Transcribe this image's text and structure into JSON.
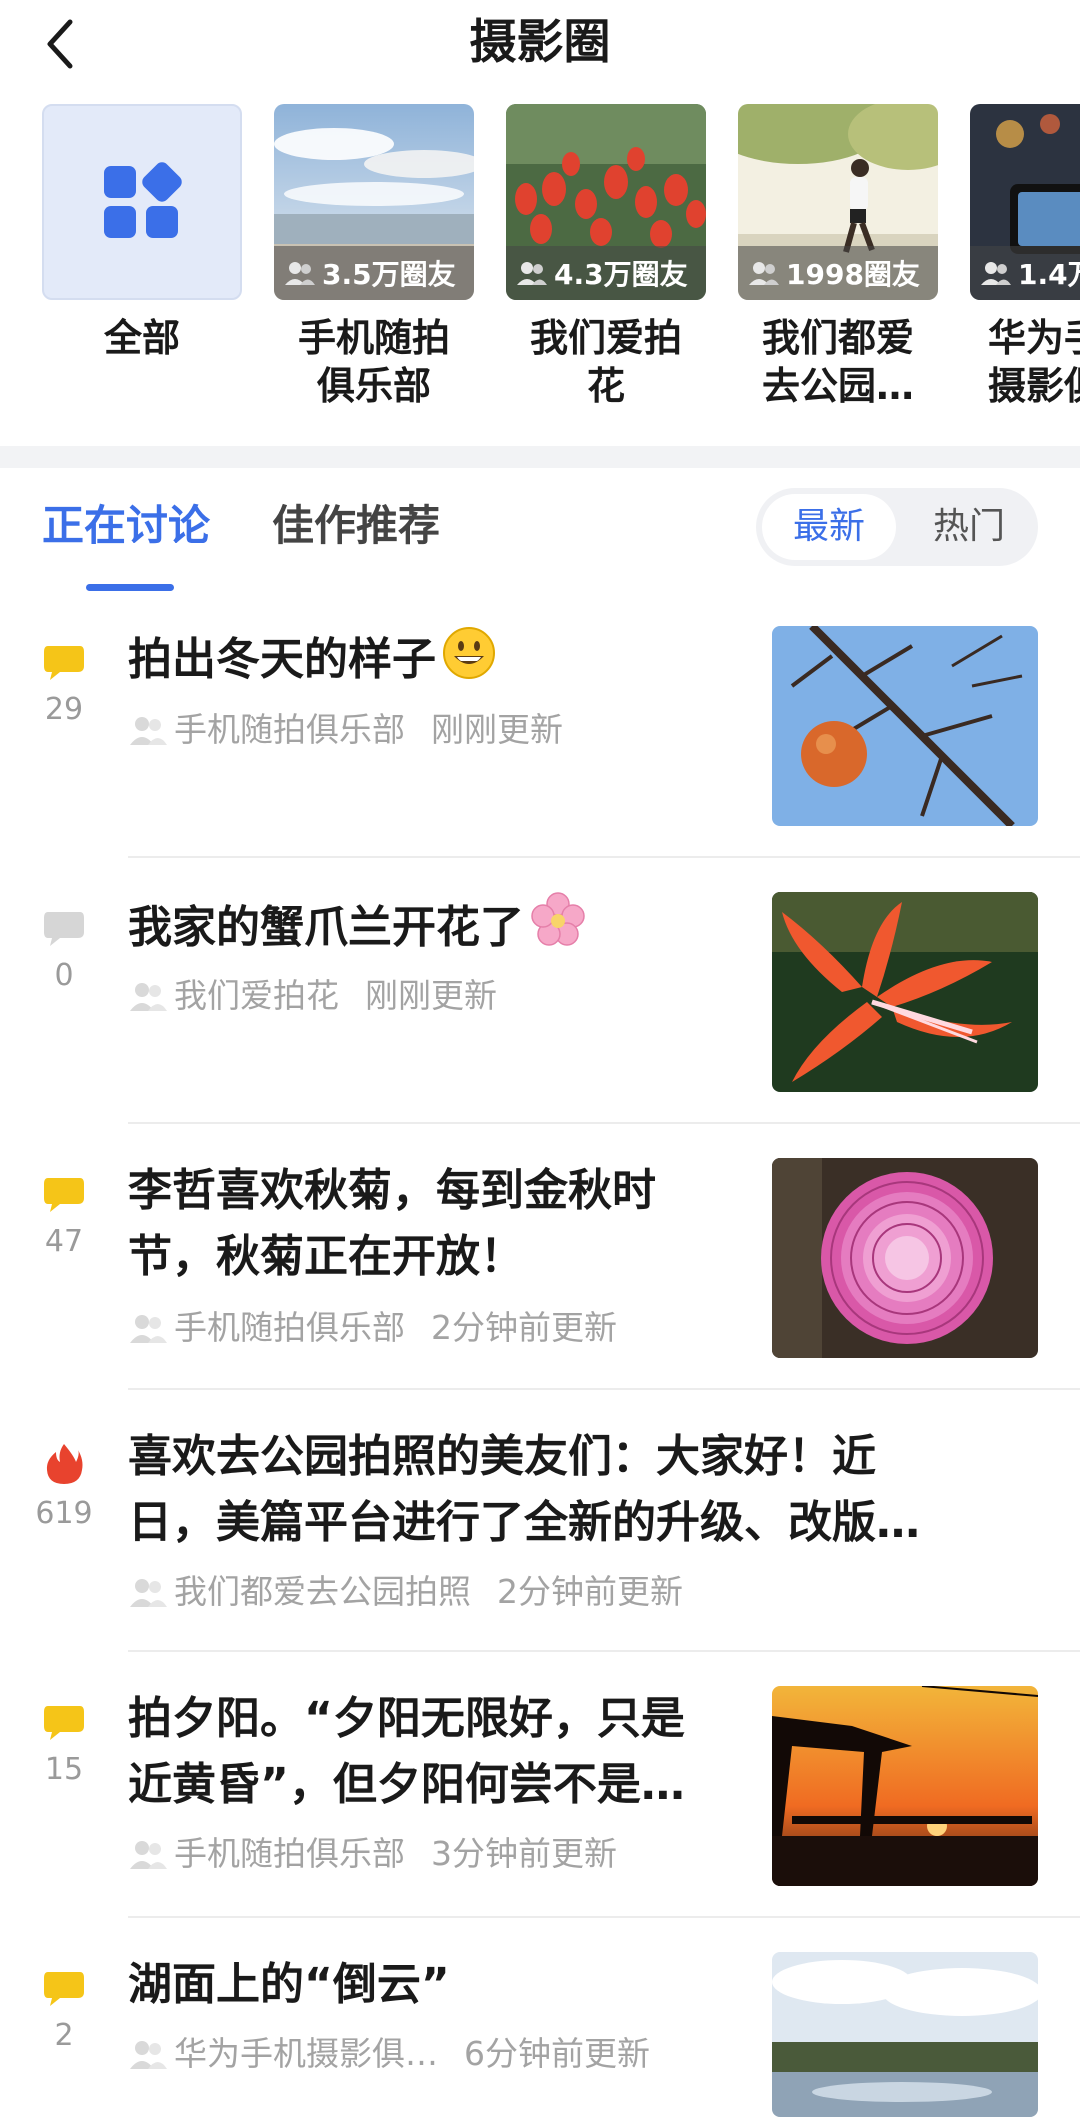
{
  "header": {
    "title": "摄影圈"
  },
  "circles": [
    {
      "label_line1": "全部",
      "label_line2": "",
      "members": ""
    },
    {
      "label_line1": "手机随拍",
      "label_line2": "俱乐部",
      "members": "3.5万圈友"
    },
    {
      "label_line1": "我们爱拍",
      "label_line2": "花",
      "members": "4.3万圈友"
    },
    {
      "label_line1": "我们都爱",
      "label_line2": "去公园…",
      "members": "1998圈友"
    },
    {
      "label_line1": "华为手",
      "label_line2": "摄影俱",
      "members": "1.4万"
    }
  ],
  "tabs": {
    "active": "正在讨论",
    "inactive": "佳作推荐"
  },
  "sort": {
    "new": "最新",
    "hot": "热门"
  },
  "posts": [
    {
      "title_line1": "拍出冬天的样子",
      "title_line2": "",
      "count": "29",
      "group": "手机随拍俱乐部",
      "time": "刚刚更新",
      "icon": "comment-icon",
      "icon_color": "#f5c518",
      "emoji": "grinning-face-emoji"
    },
    {
      "title_line1": "我家的蟹爪兰开花了",
      "title_line2": "",
      "count": "0",
      "group": "我们爱拍花",
      "time": "刚刚更新",
      "icon": "comment-icon",
      "icon_color": "#d6d6d6",
      "emoji": "cherry-blossom-emoji"
    },
    {
      "title_line1": "李哲喜欢秋菊，每到金秋时",
      "title_line2": "节，秋菊正在开放！",
      "count": "47",
      "group": "手机随拍俱乐部",
      "time": "2分钟前更新",
      "icon": "comment-icon",
      "icon_color": "#f5c518"
    },
    {
      "title_line1": "喜欢去公园拍照的美友们：大家好！近",
      "title_line2": "日，美篇平台进行了全新的升级、改版…",
      "count": "619",
      "group": "我们都爱去公园拍照",
      "time": "2分钟前更新",
      "icon": "fire-icon",
      "icon_color": "#e8432e"
    },
    {
      "title_line1": "拍夕阳。“夕阳无限好，只是",
      "title_line2": "近黄昏”，但夕阳何尝不是…",
      "count": "15",
      "group": "手机随拍俱乐部",
      "time": "3分钟前更新",
      "icon": "comment-icon",
      "icon_color": "#f5c518"
    },
    {
      "title_line1": "湖面上的“倒云”",
      "title_line2": "",
      "count": "2",
      "group": "华为手机摄影俱…",
      "time": "6分钟前更新",
      "icon": "comment-icon",
      "icon_color": "#f5c518"
    }
  ],
  "colors": {
    "accent": "#3b6fe8",
    "comment_yellow": "#f5c518",
    "comment_gray": "#d6d6d6",
    "hot_red": "#e8432e"
  }
}
